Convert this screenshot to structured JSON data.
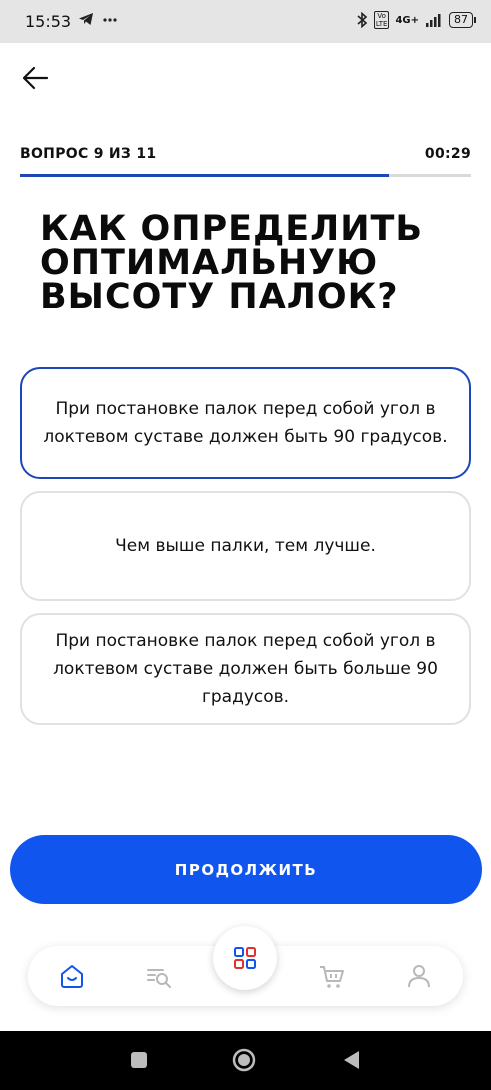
{
  "status_bar": {
    "time": "15:53",
    "network": "4G+",
    "battery": "87",
    "volte": "Vo\nLTE",
    "icons": [
      "telegram-icon",
      "more-dots-icon",
      "bluetooth-icon",
      "signal-icon"
    ]
  },
  "header": {
    "question_counter": "ВОПРОС 9 ИЗ 11",
    "timer": "00:29",
    "progress_fraction": 0.818
  },
  "question": {
    "text": "КАК ОПРЕДЕЛИТЬ ОПТИМАЛЬНУЮ ВЫСОТУ ПАЛОК?"
  },
  "options": [
    {
      "text": "При постановке палок перед собой угол в локтевом суставе должен быть 90 градусов.",
      "selected": true
    },
    {
      "text": "Чем выше палки, тем лучше.",
      "selected": false
    },
    {
      "text": "При постановке палок перед собой угол в локтевом суставе должен быть больше 90 градусов.",
      "selected": false
    }
  ],
  "continue_button": {
    "label": "ПРОДОЛЖИТЬ"
  },
  "bottom_nav": {
    "items": [
      "home-icon",
      "search-list-icon",
      "catalog-grid-icon",
      "cart-icon",
      "profile-icon"
    ],
    "active": "home-icon"
  },
  "colors": {
    "accent": "#1155ef",
    "progress": "#1d46b8",
    "selected_border": "#1d46b8"
  }
}
